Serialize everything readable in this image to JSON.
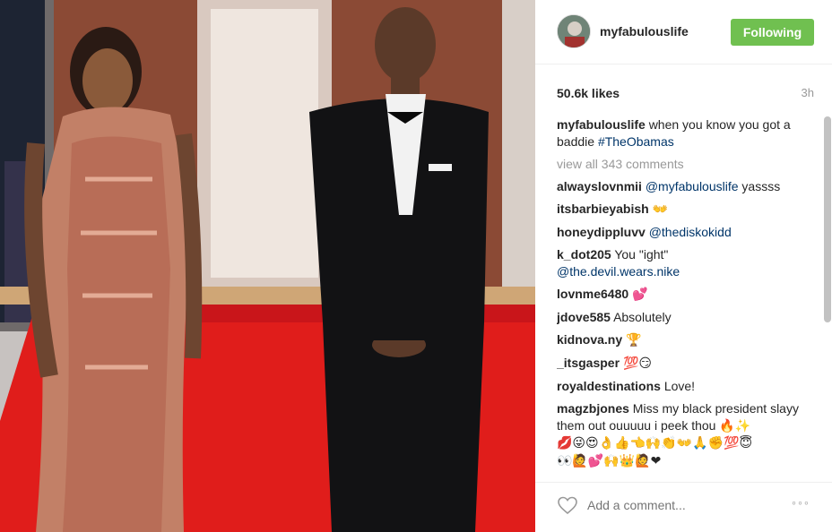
{
  "post": {
    "username": "myfabulouslife",
    "follow_label": "Following",
    "likes": "50.6k likes",
    "time": "3h",
    "caption_text": "when you know you got a baddie",
    "caption_hashtag": "#TheObamas",
    "view_all": "view all 343 comments",
    "add_comment_placeholder": "Add a comment...",
    "more_label": "◦◦◦"
  },
  "comments": [
    {
      "user": "alwayslovnmii",
      "mention": "@myfabulouslife",
      "text": " yassss"
    },
    {
      "user": "itsbarbieyabish",
      "text": "👐"
    },
    {
      "user": "honeydippluvv",
      "mention": "@thediskokidd",
      "text": ""
    },
    {
      "user": "k_dot205",
      "text": "You \"ight\"",
      "mention2": "@the.devil.wears.nike"
    },
    {
      "user": "lovnme6480",
      "text": "💕"
    },
    {
      "user": "jdove585",
      "text": "Absolutely"
    },
    {
      "user": "kidnova.ny",
      "text": "🏆"
    },
    {
      "user": "_itsgasper",
      "text": "💯😏"
    },
    {
      "user": "royaldestinations",
      "text": "Love!"
    },
    {
      "user": "magzbjones",
      "text": "Miss my black president slayy them out ouuuuu i peek thou 🔥✨",
      "emoji_line": "💋😜😍👌👍👈🙌👏👐🙏✊💯😇",
      "emoji_line2": "👀🙋💕🙌👑🙋❤"
    }
  ],
  "colors": {
    "follow_button": "#70c050",
    "mention": "#003569",
    "muted": "#999999"
  },
  "icons": {
    "like": "heart-icon",
    "more": "more-options-icon"
  }
}
